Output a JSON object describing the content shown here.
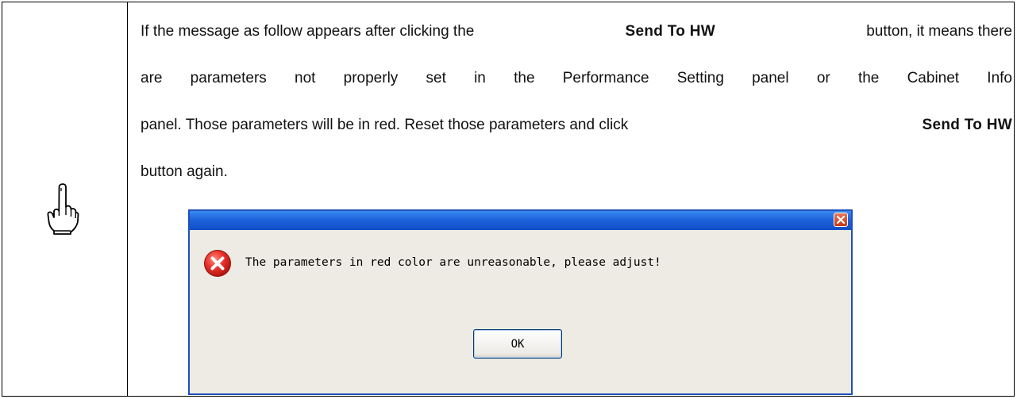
{
  "note": {
    "icon": "pointing-hand-icon",
    "paragraph": {
      "line1_pre": "If the message as follow appears after clicking the",
      "line1_bold": "Send To HW",
      "line1_post": "button, it means there",
      "line2": "are parameters not properly set in the Performance Setting panel or the Cabinet Info",
      "line3_pre": "panel. Those parameters will be in red. Reset those parameters and click",
      "line3_bold": "Send To HW",
      "line4": "button again."
    }
  },
  "dialog": {
    "title": "",
    "close_icon": "close-icon",
    "error_icon": "error-icon",
    "message": "The parameters in red color are unreasonable, please adjust!",
    "ok_label": "OK"
  }
}
